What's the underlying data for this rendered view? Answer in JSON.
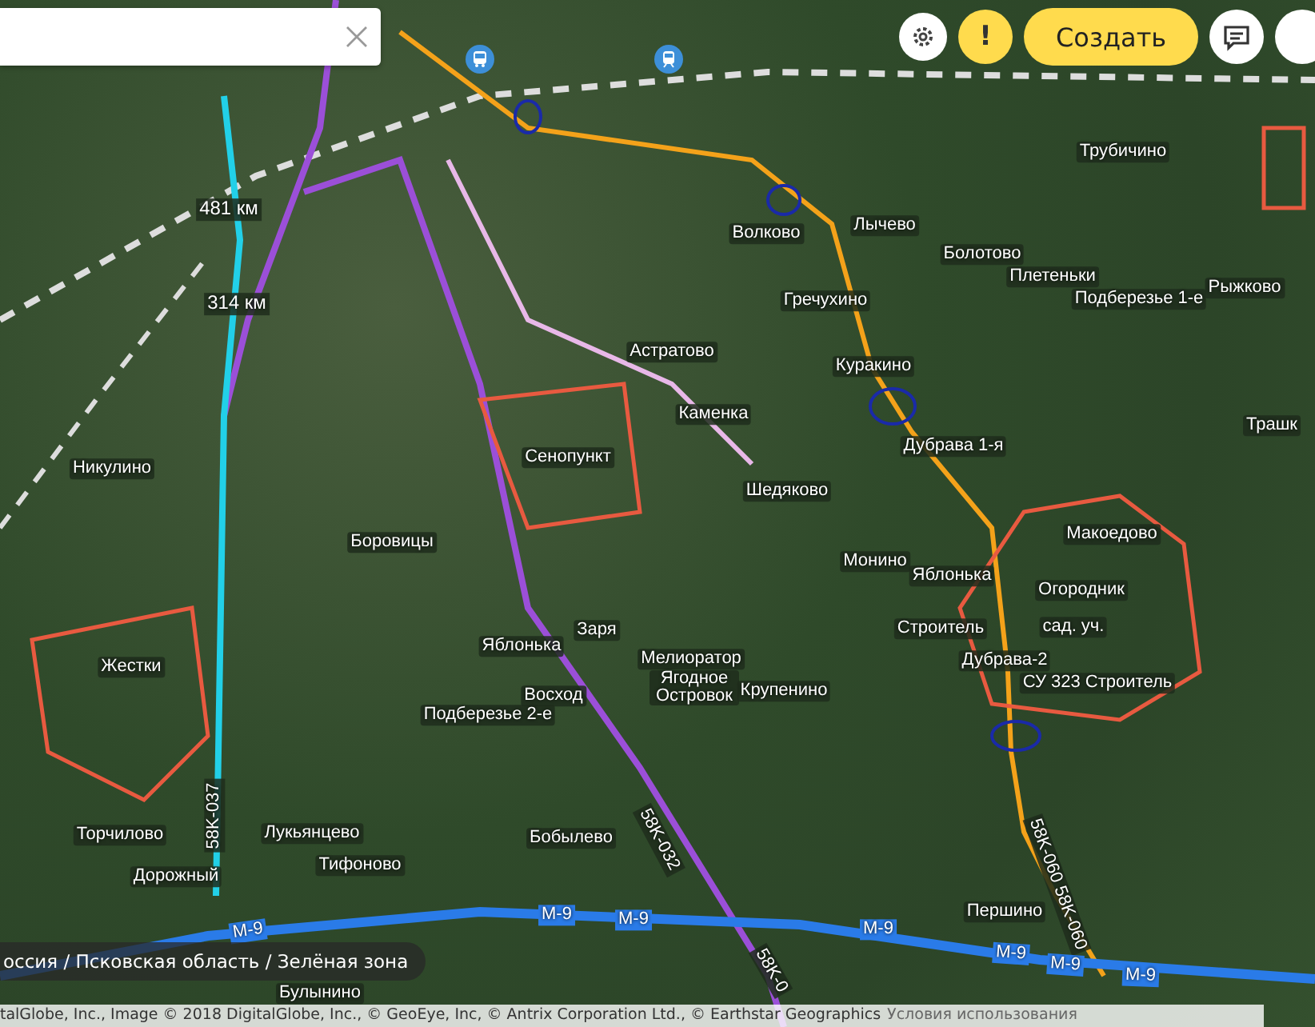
{
  "toolbar": {
    "alert_label": "!",
    "create_button": "Создать"
  },
  "places": [
    "Трубичино",
    "Волково",
    "Лычево",
    "Болотово",
    "Плетеньки",
    "Подберезье 1-е",
    "Рыжково",
    "Гречухино",
    "Астратово",
    "Куракино",
    "Каменка",
    "Трашк",
    "Дубрава 1-я",
    "Никулино",
    "Сенопункт",
    "Шедяково",
    "Макоедово",
    "Боровицы",
    "Монино",
    "Яблонька",
    "Огородник",
    "Заря",
    "Строитель",
    "сад. уч.",
    "Яблонька",
    "Мелиоратор",
    "Дубрава-2",
    "СУ 323 Строитель",
    "Жестки",
    "Восход",
    "Ягодное Островок",
    "Крупенино",
    "Подберезье 2-е",
    "Торчилово",
    "Лукьянцево",
    "Бобылево",
    "Тифоново",
    "Дорожный",
    "Першино",
    "Булынино"
  ],
  "road_labels": [
    {
      "kind": "km",
      "text": "481 км"
    },
    {
      "kind": "km",
      "text": "314 км"
    },
    {
      "kind": "route",
      "text": "58K-037"
    },
    {
      "kind": "route",
      "text": "58K-032"
    },
    {
      "kind": "route",
      "text": "58K-060 58K-060"
    },
    {
      "kind": "route",
      "text": "58K-0"
    },
    {
      "kind": "highway",
      "text": "M-9"
    },
    {
      "kind": "highway",
      "text": "M-9"
    },
    {
      "kind": "highway",
      "text": "M-9"
    },
    {
      "kind": "highway",
      "text": "M-9"
    },
    {
      "kind": "highway",
      "text": "M-9"
    },
    {
      "kind": "highway",
      "text": "M-9"
    },
    {
      "kind": "highway",
      "text": "M-9"
    }
  ],
  "breadcrumb": "оссия / Псковская область / Зелёная зона",
  "attribution": {
    "text": "talGlobe, Inc., Image © 2018 DigitalGlobe, Inc., © GeoEye, Inc, © Antrix Corporation Ltd., © Earthstar Geographics",
    "terms_link": "Условия использования"
  }
}
